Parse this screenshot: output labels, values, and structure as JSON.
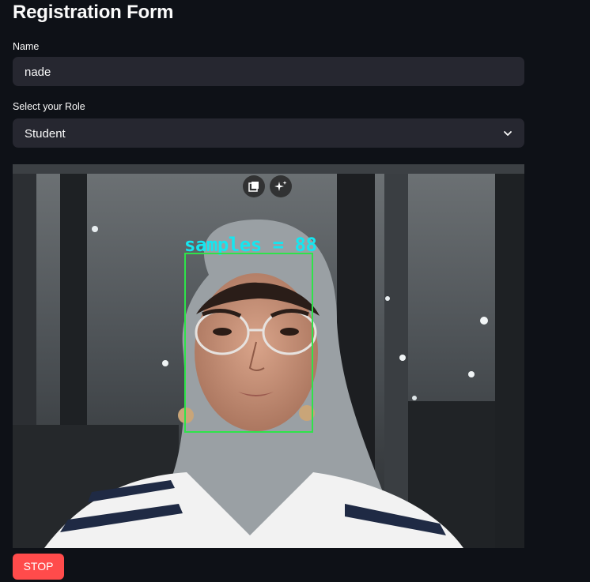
{
  "form": {
    "title": "Registration Form",
    "name_label": "Name",
    "name_value": "nade",
    "role_label": "Select your Role",
    "role_value": "Student"
  },
  "video": {
    "overlay_text": "samples = 88",
    "box_color": "#2ee34a",
    "text_color": "#16e6f0",
    "controls": {
      "pip_icon": "picture-in-picture-icon",
      "enhance_icon": "sparkle-icon"
    }
  },
  "actions": {
    "stop_label": "STOP",
    "stop_color": "#ff4b4b"
  },
  "theme": {
    "background": "#0e1117",
    "input_background": "#262730",
    "text": "#fafafa"
  }
}
